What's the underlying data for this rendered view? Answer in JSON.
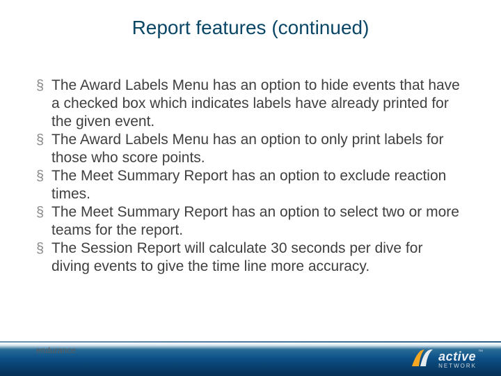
{
  "title": "Report features (continued)",
  "bullets": [
    "The Award Labels Menu has an option to hide events that have a checked box which indicates labels have already printed for the given event.",
    "The Award Labels Menu has an option to only print labels for those who score points.",
    "The Meet Summary Report has an option to exclude reaction times.",
    "The Meet Summary Report has an option to select two or more teams for the report.",
    "The Session Report will calculate 30 seconds per dive for diving events to give the time line more accuracy."
  ],
  "footer": {
    "label": "endurance",
    "logo_word": "active",
    "logo_sub": "NETWORK",
    "logo_tm": "™"
  },
  "bullet_glyph": "§"
}
